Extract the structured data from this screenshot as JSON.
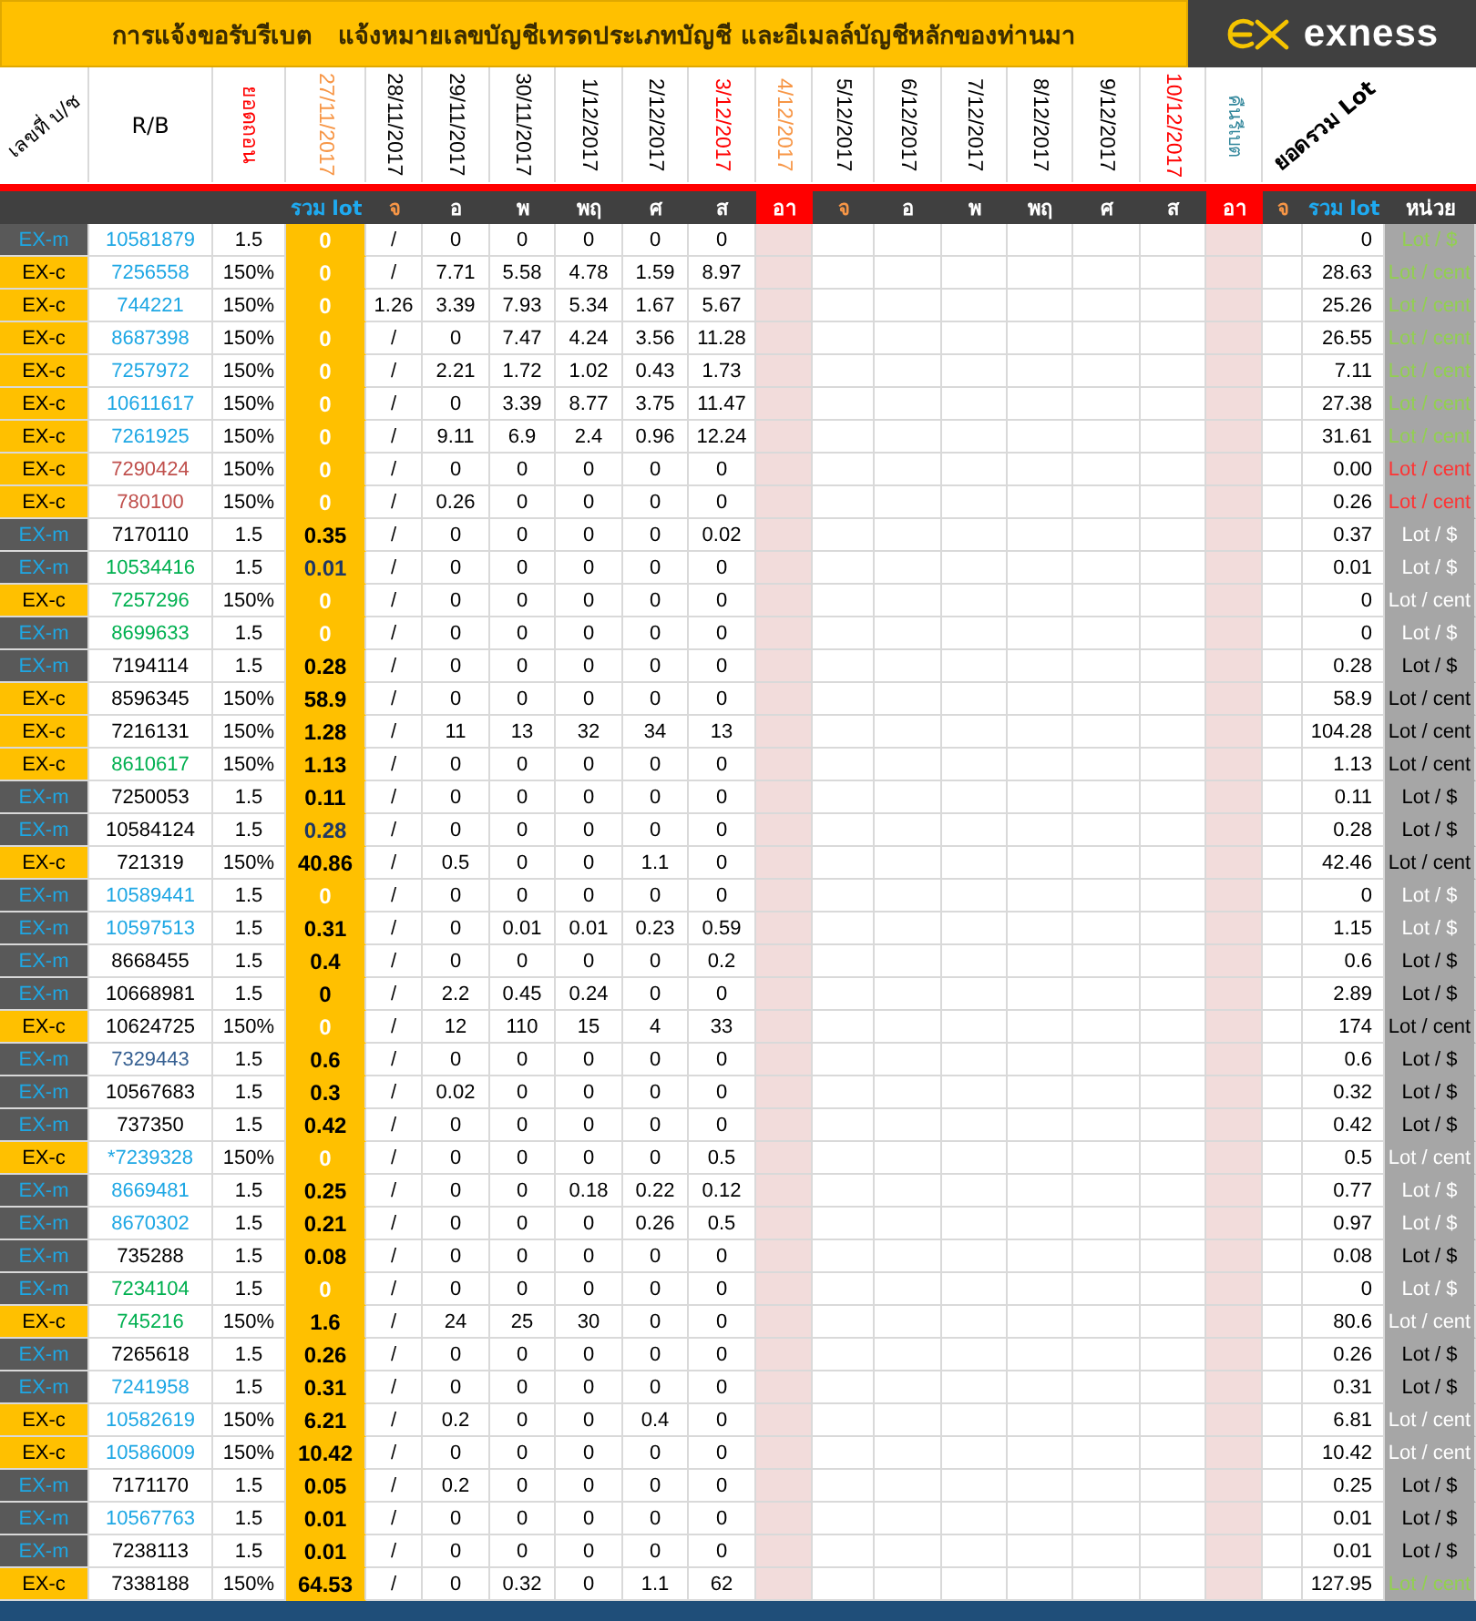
{
  "title": "การแจ้งขอรับรีเบต   แจ้งหมายเลขบัญชีเทรดประเภทบัญชี และอีเมลล์บัญชีหลักของท่านมา",
  "logo": {
    "text": "exness"
  },
  "header": {
    "account": "เลขที่ บ/ช",
    "rb": "R/B",
    "withdraw": "ยอดถอน",
    "rebate_return": "คืนรีเบต",
    "total": "ยอดรวม Lot",
    "dates": [
      {
        "label": "27/11/2017",
        "color": "#f79646"
      },
      {
        "label": "28/11/2017",
        "color": "#000000"
      },
      {
        "label": "29/11/2017",
        "color": "#000000"
      },
      {
        "label": "30/11/2017",
        "color": "#000000"
      },
      {
        "label": "1/12/2017",
        "color": "#000000"
      },
      {
        "label": "2/12/2017",
        "color": "#000000"
      },
      {
        "label": "3/12/2017",
        "color": "#ff0000"
      },
      {
        "label": "4/12/2017",
        "color": "#f79646"
      },
      {
        "label": "5/12/2017",
        "color": "#000000"
      },
      {
        "label": "6/12/2017",
        "color": "#000000"
      },
      {
        "label": "7/12/2017",
        "color": "#000000"
      },
      {
        "label": "8/12/2017",
        "color": "#000000"
      },
      {
        "label": "9/12/2017",
        "color": "#000000"
      },
      {
        "label": "10/12/2017",
        "color": "#ff0000"
      }
    ]
  },
  "subheader": {
    "rebate_sum": "รวม lot",
    "total_sum": "รวม lot",
    "unit": "หน่วย",
    "days": [
      {
        "label": "จ",
        "kind": "monday"
      },
      {
        "label": "อ",
        "kind": "weekday"
      },
      {
        "label": "พ",
        "kind": "weekday"
      },
      {
        "label": "พฤ",
        "kind": "weekday"
      },
      {
        "label": "ศ",
        "kind": "weekday"
      },
      {
        "label": "ส",
        "kind": "weekday"
      },
      {
        "label": "อา",
        "kind": "sunday"
      },
      {
        "label": "จ",
        "kind": "monday"
      },
      {
        "label": "อ",
        "kind": "weekday"
      },
      {
        "label": "พ",
        "kind": "weekday"
      },
      {
        "label": "พฤ",
        "kind": "weekday"
      },
      {
        "label": "ศ",
        "kind": "weekday"
      },
      {
        "label": "ส",
        "kind": "weekday"
      },
      {
        "label": "อา",
        "kind": "sunday"
      },
      {
        "label": "จ",
        "kind": "monday"
      }
    ]
  },
  "rows": [
    {
      "type": "EX-m",
      "kind": "m",
      "account": {
        "text": "10581879",
        "color": "#1ea7e4"
      },
      "rb": "1.5",
      "rebate": {
        "text": "0",
        "color": "#ffffff"
      },
      "lots": [
        "/",
        "0",
        "0",
        "0",
        "0",
        "0"
      ],
      "total": "0",
      "unit": {
        "text": "Lot / $",
        "color": "#92d050"
      }
    },
    {
      "type": "EX-c",
      "kind": "c",
      "account": {
        "text": "7256558",
        "color": "#1ea7e4"
      },
      "rb": "150%",
      "rebate": {
        "text": "0",
        "color": "#ffffff"
      },
      "lots": [
        "/",
        "7.71",
        "5.58",
        "4.78",
        "1.59",
        "8.97"
      ],
      "total": "28.63",
      "unit": {
        "text": "Lot / cent",
        "color": "#92d050"
      }
    },
    {
      "type": "EX-c",
      "kind": "c",
      "account": {
        "text": "744221",
        "color": "#1ea7e4"
      },
      "rb": "150%",
      "rebate": {
        "text": "0",
        "color": "#ffffff"
      },
      "lots": [
        "1.26",
        "3.39",
        "7.93",
        "5.34",
        "1.67",
        "5.67"
      ],
      "total": "25.26",
      "unit": {
        "text": "Lot / cent",
        "color": "#92d050"
      }
    },
    {
      "type": "EX-c",
      "kind": "c",
      "account": {
        "text": "8687398",
        "color": "#1ea7e4"
      },
      "rb": "150%",
      "rebate": {
        "text": "0",
        "color": "#ffffff"
      },
      "lots": [
        "/",
        "0",
        "7.47",
        "4.24",
        "3.56",
        "11.28"
      ],
      "total": "26.55",
      "unit": {
        "text": "Lot / cent",
        "color": "#92d050"
      }
    },
    {
      "type": "EX-c",
      "kind": "c",
      "account": {
        "text": "7257972",
        "color": "#1ea7e4"
      },
      "rb": "150%",
      "rebate": {
        "text": "0",
        "color": "#ffffff"
      },
      "lots": [
        "/",
        "2.21",
        "1.72",
        "1.02",
        "0.43",
        "1.73"
      ],
      "total": "7.11",
      "unit": {
        "text": "Lot / cent",
        "color": "#92d050"
      }
    },
    {
      "type": "EX-c",
      "kind": "c",
      "account": {
        "text": "10611617",
        "color": "#1ea7e4"
      },
      "rb": "150%",
      "rebate": {
        "text": "0",
        "color": "#ffffff"
      },
      "lots": [
        "/",
        "0",
        "3.39",
        "8.77",
        "3.75",
        "11.47"
      ],
      "total": "27.38",
      "unit": {
        "text": "Lot / cent",
        "color": "#92d050"
      }
    },
    {
      "type": "EX-c",
      "kind": "c",
      "account": {
        "text": "7261925",
        "color": "#1ea7e4"
      },
      "rb": "150%",
      "rebate": {
        "text": "0",
        "color": "#ffffff"
      },
      "lots": [
        "/",
        "9.11",
        "6.9",
        "2.4",
        "0.96",
        "12.24"
      ],
      "total": "31.61",
      "unit": {
        "text": "Lot / cent",
        "color": "#92d050"
      }
    },
    {
      "type": "EX-c",
      "kind": "c",
      "account": {
        "text": "7290424",
        "color": "#c0504d"
      },
      "rb": "150%",
      "rebate": {
        "text": "0",
        "color": "#ffffff"
      },
      "lots": [
        "/",
        "0",
        "0",
        "0",
        "0",
        "0"
      ],
      "total": "0.00",
      "unit": {
        "text": "Lot / cent",
        "color": "#ff3333"
      }
    },
    {
      "type": "EX-c",
      "kind": "c",
      "account": {
        "text": "780100",
        "color": "#c0504d"
      },
      "rb": "150%",
      "rebate": {
        "text": "0",
        "color": "#ffffff"
      },
      "lots": [
        "/",
        "0.26",
        "0",
        "0",
        "0",
        "0"
      ],
      "total": "0.26",
      "unit": {
        "text": "Lot / cent",
        "color": "#ff3333"
      }
    },
    {
      "type": "EX-m",
      "kind": "m",
      "account": {
        "text": "7170110",
        "color": "#000000"
      },
      "rb": "1.5",
      "rebate": {
        "text": "0.35",
        "color": "#000000"
      },
      "lots": [
        "/",
        "0",
        "0",
        "0",
        "0",
        "0.02"
      ],
      "total": "0.37",
      "unit": {
        "text": "Lot / $",
        "color": "#ffffff"
      }
    },
    {
      "type": "EX-m",
      "kind": "m",
      "account": {
        "text": "10534416",
        "color": "#00b050"
      },
      "rb": "1.5",
      "rebate": {
        "text": "0.01",
        "color": "#1f3864"
      },
      "lots": [
        "/",
        "0",
        "0",
        "0",
        "0",
        "0"
      ],
      "total": "0.01",
      "unit": {
        "text": "Lot / $",
        "color": "#ffffff"
      }
    },
    {
      "type": "EX-c",
      "kind": "c",
      "account": {
        "text": "7257296",
        "color": "#00b050"
      },
      "rb": "150%",
      "rebate": {
        "text": "0",
        "color": "#ffffff"
      },
      "lots": [
        "/",
        "0",
        "0",
        "0",
        "0",
        "0"
      ],
      "total": "0",
      "unit": {
        "text": "Lot / cent",
        "color": "#ffffff"
      }
    },
    {
      "type": "EX-m",
      "kind": "m",
      "account": {
        "text": "8699633",
        "color": "#00b050"
      },
      "rb": "1.5",
      "rebate": {
        "text": "0",
        "color": "#ffffff"
      },
      "lots": [
        "/",
        "0",
        "0",
        "0",
        "0",
        "0"
      ],
      "total": "0",
      "unit": {
        "text": "Lot / $",
        "color": "#ffffff"
      }
    },
    {
      "type": "EX-m",
      "kind": "m",
      "account": {
        "text": "7194114",
        "color": "#000000"
      },
      "rb": "1.5",
      "rebate": {
        "text": "0.28",
        "color": "#000000"
      },
      "lots": [
        "/",
        "0",
        "0",
        "0",
        "0",
        "0"
      ],
      "total": "0.28",
      "unit": {
        "text": "Lot / $",
        "color": "#000000"
      }
    },
    {
      "type": "EX-c",
      "kind": "c",
      "account": {
        "text": "8596345",
        "color": "#000000"
      },
      "rb": "150%",
      "rebate": {
        "text": "58.9",
        "color": "#000000"
      },
      "lots": [
        "/",
        "0",
        "0",
        "0",
        "0",
        "0"
      ],
      "total": "58.9",
      "unit": {
        "text": "Lot / cent",
        "color": "#000000"
      }
    },
    {
      "type": "EX-c",
      "kind": "c",
      "account": {
        "text": "7216131",
        "color": "#000000"
      },
      "rb": "150%",
      "rebate": {
        "text": "1.28",
        "color": "#000000"
      },
      "lots": [
        "/",
        "11",
        "13",
        "32",
        "34",
        "13"
      ],
      "total": "104.28",
      "unit": {
        "text": "Lot / cent",
        "color": "#000000"
      }
    },
    {
      "type": "EX-c",
      "kind": "c",
      "account": {
        "text": "8610617",
        "color": "#00b050"
      },
      "rb": "150%",
      "rebate": {
        "text": "1.13",
        "color": "#000000"
      },
      "lots": [
        "/",
        "0",
        "0",
        "0",
        "0",
        "0"
      ],
      "total": "1.13",
      "unit": {
        "text": "Lot / cent",
        "color": "#000000"
      }
    },
    {
      "type": "EX-m",
      "kind": "m",
      "account": {
        "text": "7250053",
        "color": "#000000"
      },
      "rb": "1.5",
      "rebate": {
        "text": "0.11",
        "color": "#000000"
      },
      "lots": [
        "/",
        "0",
        "0",
        "0",
        "0",
        "0"
      ],
      "total": "0.11",
      "unit": {
        "text": "Lot / $",
        "color": "#000000"
      }
    },
    {
      "type": "EX-m",
      "kind": "m",
      "account": {
        "text": "10584124",
        "color": "#000000"
      },
      "rb": "1.5",
      "rebate": {
        "text": "0.28",
        "color": "#1f3864"
      },
      "lots": [
        "/",
        "0",
        "0",
        "0",
        "0",
        "0"
      ],
      "total": "0.28",
      "unit": {
        "text": "Lot / $",
        "color": "#000000"
      }
    },
    {
      "type": "EX-c",
      "kind": "c",
      "account": {
        "text": "721319",
        "color": "#000000"
      },
      "rb": "150%",
      "rebate": {
        "text": "40.86",
        "color": "#000000"
      },
      "lots": [
        "/",
        "0.5",
        "0",
        "0",
        "1.1",
        "0"
      ],
      "total": "42.46",
      "unit": {
        "text": "Lot / cent",
        "color": "#000000"
      }
    },
    {
      "type": "EX-m",
      "kind": "m",
      "account": {
        "text": "10589441",
        "color": "#1ea7e4"
      },
      "rb": "1.5",
      "rebate": {
        "text": "0",
        "color": "#ffffff"
      },
      "lots": [
        "/",
        "0",
        "0",
        "0",
        "0",
        "0"
      ],
      "total": "0",
      "unit": {
        "text": "Lot / $",
        "color": "#ffffff"
      }
    },
    {
      "type": "EX-m",
      "kind": "m",
      "account": {
        "text": "10597513",
        "color": "#1ea7e4"
      },
      "rb": "1.5",
      "rebate": {
        "text": "0.31",
        "color": "#000000"
      },
      "lots": [
        "/",
        "0",
        "0.01",
        "0.01",
        "0.23",
        "0.59"
      ],
      "total": "1.15",
      "unit": {
        "text": "Lot / $",
        "color": "#ffffff"
      }
    },
    {
      "type": "EX-m",
      "kind": "m",
      "account": {
        "text": "8668455",
        "color": "#000000"
      },
      "rb": "1.5",
      "rebate": {
        "text": "0.4",
        "color": "#000000"
      },
      "lots": [
        "/",
        "0",
        "0",
        "0",
        "0",
        "0.2"
      ],
      "total": "0.6",
      "unit": {
        "text": "Lot / $",
        "color": "#000000"
      }
    },
    {
      "type": "EX-m",
      "kind": "m",
      "account": {
        "text": "10668981",
        "color": "#000000"
      },
      "rb": "1.5",
      "rebate": {
        "text": "0",
        "color": "#000000"
      },
      "lots": [
        "/",
        "2.2",
        "0.45",
        "0.24",
        "0",
        "0"
      ],
      "total": "2.89",
      "unit": {
        "text": "Lot / $",
        "color": "#000000"
      }
    },
    {
      "type": "EX-c",
      "kind": "c",
      "account": {
        "text": "10624725",
        "color": "#000000"
      },
      "rb": "150%",
      "rebate": {
        "text": "0",
        "color": "#ffffff"
      },
      "lots": [
        "/",
        "12",
        "110",
        "15",
        "4",
        "33"
      ],
      "total": "174",
      "unit": {
        "text": "Lot / cent",
        "color": "#000000"
      }
    },
    {
      "type": "EX-m",
      "kind": "m",
      "account": {
        "text": "7329443",
        "color": "#366092"
      },
      "rb": "1.5",
      "rebate": {
        "text": "0.6",
        "color": "#000000"
      },
      "lots": [
        "/",
        "0",
        "0",
        "0",
        "0",
        "0"
      ],
      "total": "0.6",
      "unit": {
        "text": "Lot / $",
        "color": "#000000"
      }
    },
    {
      "type": "EX-m",
      "kind": "m",
      "account": {
        "text": "10567683",
        "color": "#000000"
      },
      "rb": "1.5",
      "rebate": {
        "text": "0.3",
        "color": "#000000"
      },
      "lots": [
        "/",
        "0.02",
        "0",
        "0",
        "0",
        "0"
      ],
      "total": "0.32",
      "unit": {
        "text": "Lot / $",
        "color": "#000000"
      }
    },
    {
      "type": "EX-m",
      "kind": "m",
      "account": {
        "text": "737350",
        "color": "#000000"
      },
      "rb": "1.5",
      "rebate": {
        "text": "0.42",
        "color": "#000000"
      },
      "lots": [
        "/",
        "0",
        "0",
        "0",
        "0",
        "0"
      ],
      "total": "0.42",
      "unit": {
        "text": "Lot / $",
        "color": "#000000"
      }
    },
    {
      "type": "EX-c",
      "kind": "c",
      "account": {
        "text": "*7239328",
        "color": "#1ea7e4"
      },
      "rb": "150%",
      "rebate": {
        "text": "0",
        "color": "#ffffff"
      },
      "lots": [
        "/",
        "0",
        "0",
        "0",
        "0",
        "0.5"
      ],
      "total": "0.5",
      "unit": {
        "text": "Lot / cent",
        "color": "#ffffff"
      }
    },
    {
      "type": "EX-m",
      "kind": "m",
      "account": {
        "text": "8669481",
        "color": "#1ea7e4"
      },
      "rb": "1.5",
      "rebate": {
        "text": "0.25",
        "color": "#000000"
      },
      "lots": [
        "/",
        "0",
        "0",
        "0.18",
        "0.22",
        "0.12"
      ],
      "total": "0.77",
      "unit": {
        "text": "Lot / $",
        "color": "#ffffff"
      }
    },
    {
      "type": "EX-m",
      "kind": "m",
      "account": {
        "text": "8670302",
        "color": "#1ea7e4"
      },
      "rb": "1.5",
      "rebate": {
        "text": "0.21",
        "color": "#000000"
      },
      "lots": [
        "/",
        "0",
        "0",
        "0",
        "0.26",
        "0.5"
      ],
      "total": "0.97",
      "unit": {
        "text": "Lot / $",
        "color": "#ffffff"
      }
    },
    {
      "type": "EX-m",
      "kind": "m",
      "account": {
        "text": "735288",
        "color": "#000000"
      },
      "rb": "1.5",
      "rebate": {
        "text": "0.08",
        "color": "#000000"
      },
      "lots": [
        "/",
        "0",
        "0",
        "0",
        "0",
        "0"
      ],
      "total": "0.08",
      "unit": {
        "text": "Lot / $",
        "color": "#000000"
      }
    },
    {
      "type": "EX-m",
      "kind": "m",
      "account": {
        "text": "7234104",
        "color": "#00b050"
      },
      "rb": "1.5",
      "rebate": {
        "text": "0",
        "color": "#ffffff"
      },
      "lots": [
        "/",
        "0",
        "0",
        "0",
        "0",
        "0"
      ],
      "total": "0",
      "unit": {
        "text": "Lot / $",
        "color": "#ffffff"
      }
    },
    {
      "type": "EX-c",
      "kind": "c",
      "account": {
        "text": "745216",
        "color": "#00b050"
      },
      "rb": "150%",
      "rebate": {
        "text": "1.6",
        "color": "#000000"
      },
      "lots": [
        "/",
        "24",
        "25",
        "30",
        "0",
        "0"
      ],
      "total": "80.6",
      "unit": {
        "text": "Lot / cent",
        "color": "#ffffff"
      }
    },
    {
      "type": "EX-m",
      "kind": "m",
      "account": {
        "text": "7265618",
        "color": "#000000"
      },
      "rb": "1.5",
      "rebate": {
        "text": "0.26",
        "color": "#000000"
      },
      "lots": [
        "/",
        "0",
        "0",
        "0",
        "0",
        "0"
      ],
      "total": "0.26",
      "unit": {
        "text": "Lot / $",
        "color": "#000000"
      }
    },
    {
      "type": "EX-m",
      "kind": "m",
      "account": {
        "text": "7241958",
        "color": "#1ea7e4"
      },
      "rb": "1.5",
      "rebate": {
        "text": "0.31",
        "color": "#000000"
      },
      "lots": [
        "/",
        "0",
        "0",
        "0",
        "0",
        "0"
      ],
      "total": "0.31",
      "unit": {
        "text": "Lot / $",
        "color": "#000000"
      }
    },
    {
      "type": "EX-c",
      "kind": "c",
      "account": {
        "text": "10582619",
        "color": "#1ea7e4"
      },
      "rb": "150%",
      "rebate": {
        "text": "6.21",
        "color": "#000000"
      },
      "lots": [
        "/",
        "0.2",
        "0",
        "0",
        "0.4",
        "0"
      ],
      "total": "6.81",
      "unit": {
        "text": "Lot / cent",
        "color": "#ffffff"
      }
    },
    {
      "type": "EX-c",
      "kind": "c",
      "account": {
        "text": "10586009",
        "color": "#1ea7e4"
      },
      "rb": "150%",
      "rebate": {
        "text": "10.42",
        "color": "#000000"
      },
      "lots": [
        "/",
        "0",
        "0",
        "0",
        "0",
        "0"
      ],
      "total": "10.42",
      "unit": {
        "text": "Lot / cent",
        "color": "#ffffff"
      }
    },
    {
      "type": "EX-m",
      "kind": "m",
      "account": {
        "text": "7171170",
        "color": "#000000"
      },
      "rb": "1.5",
      "rebate": {
        "text": "0.05",
        "color": "#000000"
      },
      "lots": [
        "/",
        "0.2",
        "0",
        "0",
        "0",
        "0"
      ],
      "total": "0.25",
      "unit": {
        "text": "Lot / $",
        "color": "#000000"
      }
    },
    {
      "type": "EX-m",
      "kind": "m",
      "account": {
        "text": "10567763",
        "color": "#1ea7e4"
      },
      "rb": "1.5",
      "rebate": {
        "text": "0.01",
        "color": "#000000"
      },
      "lots": [
        "/",
        "0",
        "0",
        "0",
        "0",
        "0"
      ],
      "total": "0.01",
      "unit": {
        "text": "Lot / $",
        "color": "#000000"
      }
    },
    {
      "type": "EX-m",
      "kind": "m",
      "account": {
        "text": "7238113",
        "color": "#000000"
      },
      "rb": "1.5",
      "rebate": {
        "text": "0.01",
        "color": "#000000"
      },
      "lots": [
        "/",
        "0",
        "0",
        "0",
        "0",
        "0"
      ],
      "total": "0.01",
      "unit": {
        "text": "Lot / $",
        "color": "#000000"
      }
    },
    {
      "type": "EX-c",
      "kind": "c",
      "account": {
        "text": "7338188",
        "color": "#000000"
      },
      "rb": "150%",
      "rebate": {
        "text": "64.53",
        "color": "#000000"
      },
      "lots": [
        "/",
        "0",
        "0.32",
        "0",
        "1.1",
        "62"
      ],
      "total": "127.95",
      "unit": {
        "text": "Lot / cent",
        "color": "#92d050"
      }
    }
  ]
}
